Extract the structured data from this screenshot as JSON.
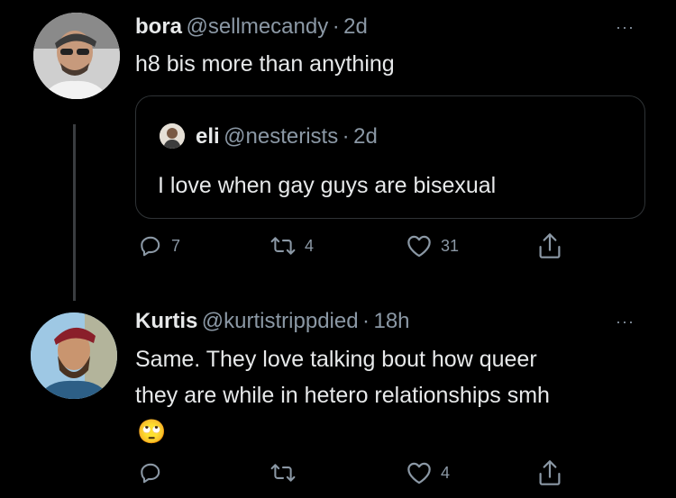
{
  "tweet1": {
    "name": "bora",
    "handle": "@sellmecandy",
    "sep": "·",
    "time": "2d",
    "text": "h8 bis more than anything",
    "more": "···",
    "quoted": {
      "name": "eli",
      "handle": "@nesterists",
      "sep": "·",
      "time": "2d",
      "text": "I love when gay guys are bisexual"
    },
    "actions": {
      "reply_count": "7",
      "retweet_count": "4",
      "like_count": "31"
    }
  },
  "tweet2": {
    "name": "Kurtis",
    "handle": "@kurtistrippdied",
    "sep": "·",
    "time": "18h",
    "text_line1": "Same. They love talking bout how queer",
    "text_line2": "they are while in hetero relationships smh",
    "emoji": "🙄",
    "more": "···",
    "actions": {
      "reply_count": "",
      "retweet_count": "",
      "like_count": "4"
    }
  },
  "icons": {
    "reply": "reply-icon",
    "retweet": "retweet-icon",
    "like": "heart-icon",
    "share": "share-icon",
    "more": "more-icon"
  },
  "colors": {
    "background": "#000000",
    "text": "#e7e9ea",
    "secondary": "#8b98a5",
    "border": "#2f3336"
  }
}
